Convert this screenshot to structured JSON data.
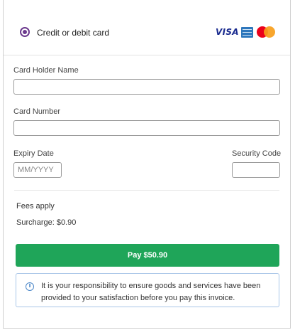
{
  "payment_method": {
    "label": "Credit or debit card",
    "selected": true,
    "card_logos": [
      "VISA",
      "amex-logo",
      "mastercard-logo"
    ]
  },
  "form": {
    "card_holder_label": "Card Holder Name",
    "card_holder_value": "",
    "card_number_label": "Card Number",
    "card_number_value": "",
    "expiry_label": "Expiry Date",
    "expiry_placeholder": "MM/YYYY",
    "security_label": "Security Code",
    "security_value": ""
  },
  "fees": {
    "heading": "Fees apply",
    "surcharge": "Surcharge: $0.90"
  },
  "pay_button_label": "Pay $50.90",
  "notice": {
    "icon": "info-icon",
    "text": "It is your responsibility to ensure goods and services have been provided to your satisfaction before you pay this invoice."
  },
  "colors": {
    "radio_accent": "#6c3a8e",
    "pay_button": "#1fa559",
    "notice_border": "#a9c6e8"
  }
}
